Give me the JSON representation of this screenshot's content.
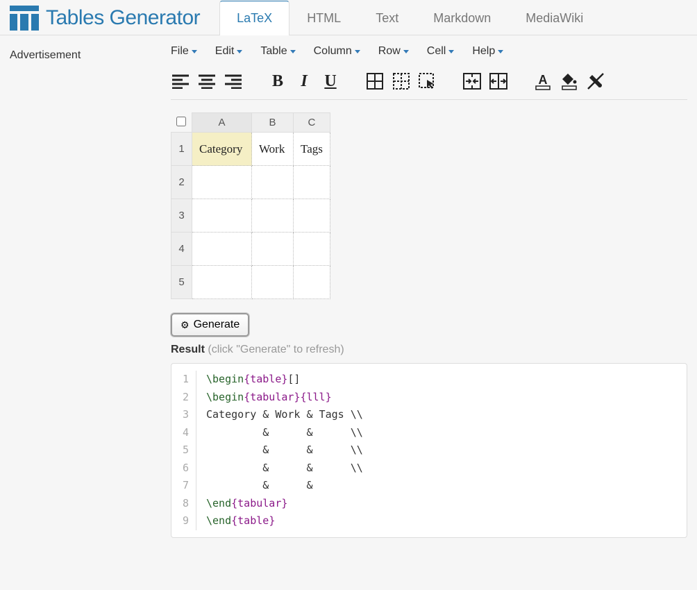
{
  "brand": "Tables Generator",
  "tabs": [
    "LaTeX",
    "HTML",
    "Text",
    "Markdown",
    "MediaWiki"
  ],
  "active_tab": 0,
  "advertisement_label": "Advertisement",
  "menus": [
    "File",
    "Edit",
    "Table",
    "Column",
    "Row",
    "Cell",
    "Help"
  ],
  "sheet": {
    "columns": [
      "A",
      "B",
      "C"
    ],
    "rows": [
      "1",
      "2",
      "3",
      "4",
      "5"
    ],
    "cells": {
      "A1": "Category",
      "B1": "Work",
      "C1": "Tags"
    },
    "selected": "A1"
  },
  "generate_label": "Generate",
  "result_label": "Result",
  "result_hint": "(click \"Generate\" to refresh)",
  "code": [
    {
      "n": "1",
      "tokens": [
        {
          "t": "cmd",
          "v": "\\begin"
        },
        {
          "t": "brace",
          "v": "{"
        },
        {
          "t": "arg",
          "v": "table"
        },
        {
          "t": "brace",
          "v": "}"
        },
        {
          "t": "plain",
          "v": "[]"
        }
      ]
    },
    {
      "n": "2",
      "tokens": [
        {
          "t": "cmd",
          "v": "\\begin"
        },
        {
          "t": "brace",
          "v": "{"
        },
        {
          "t": "arg",
          "v": "tabular"
        },
        {
          "t": "brace",
          "v": "}"
        },
        {
          "t": "brace",
          "v": "{"
        },
        {
          "t": "arg",
          "v": "lll"
        },
        {
          "t": "brace",
          "v": "}"
        }
      ]
    },
    {
      "n": "3",
      "tokens": [
        {
          "t": "plain",
          "v": "Category & Work & Tags \\\\"
        }
      ]
    },
    {
      "n": "4",
      "tokens": [
        {
          "t": "plain",
          "v": "         &      &      \\\\"
        }
      ]
    },
    {
      "n": "5",
      "tokens": [
        {
          "t": "plain",
          "v": "         &      &      \\\\"
        }
      ]
    },
    {
      "n": "6",
      "tokens": [
        {
          "t": "plain",
          "v": "         &      &      \\\\"
        }
      ]
    },
    {
      "n": "7",
      "tokens": [
        {
          "t": "plain",
          "v": "         &      &     "
        }
      ]
    },
    {
      "n": "8",
      "tokens": [
        {
          "t": "cmd",
          "v": "\\end"
        },
        {
          "t": "brace",
          "v": "{"
        },
        {
          "t": "arg",
          "v": "tabular"
        },
        {
          "t": "brace",
          "v": "}"
        }
      ]
    },
    {
      "n": "9",
      "tokens": [
        {
          "t": "cmd",
          "v": "\\end"
        },
        {
          "t": "brace",
          "v": "{"
        },
        {
          "t": "arg",
          "v": "table"
        },
        {
          "t": "brace",
          "v": "}"
        }
      ]
    }
  ]
}
